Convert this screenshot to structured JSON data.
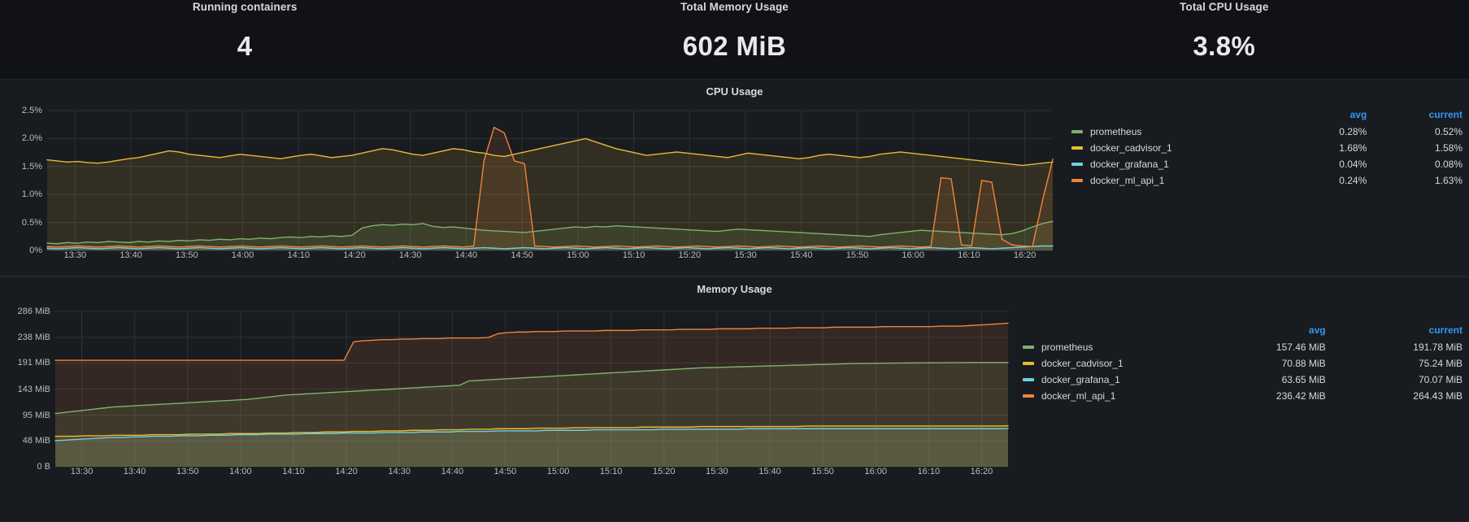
{
  "stats": [
    {
      "title": "Running containers",
      "value": "4"
    },
    {
      "title": "Total Memory Usage",
      "value": "602 MiB"
    },
    {
      "title": "Total CPU Usage",
      "value": "3.8%"
    }
  ],
  "legend_headers": {
    "series": "",
    "avg": "avg",
    "current": "current"
  },
  "colors": {
    "prometheus": "#7eb26d",
    "docker_cadvisor_1": "#eab839",
    "docker_grafana_1": "#6ed0e0",
    "docker_ml_api_1": "#ef843c",
    "panel_bg": "#181b1f",
    "page_bg": "#111217",
    "grid": "#2c3235",
    "axis_text": "#b9bcc1",
    "legend_header": "#3399f3"
  },
  "cpu_panel": {
    "title": "CPU Usage",
    "legend": [
      {
        "name": "prometheus",
        "color": "#7eb26d",
        "avg": "0.28%",
        "current": "0.52%"
      },
      {
        "name": "docker_cadvisor_1",
        "color": "#eab839",
        "avg": "1.68%",
        "current": "1.58%"
      },
      {
        "name": "docker_grafana_1",
        "color": "#6ed0e0",
        "avg": "0.04%",
        "current": "0.08%"
      },
      {
        "name": "docker_ml_api_1",
        "color": "#ef843c",
        "avg": "0.24%",
        "current": "1.63%"
      }
    ]
  },
  "memory_panel": {
    "title": "Memory Usage",
    "legend": [
      {
        "name": "prometheus",
        "color": "#7eb26d",
        "avg": "157.46 MiB",
        "current": "191.78 MiB"
      },
      {
        "name": "docker_cadvisor_1",
        "color": "#eab839",
        "avg": "70.88 MiB",
        "current": "75.24 MiB"
      },
      {
        "name": "docker_grafana_1",
        "color": "#6ed0e0",
        "avg": "63.65 MiB",
        "current": "70.07 MiB"
      },
      {
        "name": "docker_ml_api_1",
        "color": "#ef843c",
        "avg": "236.42 MiB",
        "current": "264.43 MiB"
      }
    ]
  },
  "chart_data": [
    {
      "type": "line",
      "title": "CPU Usage",
      "xlabel": "",
      "ylabel": "",
      "ylim": [
        0,
        2.5
      ],
      "yticks": [
        "0%",
        "0.5%",
        "1.0%",
        "1.5%",
        "2.0%",
        "2.5%"
      ],
      "ytick_values": [
        0,
        0.5,
        1.0,
        1.5,
        2.0,
        2.5
      ],
      "x": [
        "13:30",
        "13:40",
        "13:50",
        "14:00",
        "14:10",
        "14:20",
        "14:30",
        "14:40",
        "14:50",
        "15:00",
        "15:10",
        "15:20",
        "15:30",
        "15:40",
        "15:50",
        "16:00",
        "16:10",
        "16:20"
      ],
      "grid": true,
      "legend_position": "right",
      "fill": true,
      "series": [
        {
          "name": "prometheus",
          "color": "#7eb26d",
          "avg": 0.28,
          "current": 0.52,
          "values": [
            0.13,
            0.12,
            0.14,
            0.13,
            0.15,
            0.14,
            0.16,
            0.15,
            0.14,
            0.16,
            0.15,
            0.17,
            0.16,
            0.18,
            0.17,
            0.19,
            0.18,
            0.2,
            0.19,
            0.21,
            0.2,
            0.22,
            0.21,
            0.23,
            0.24,
            0.23,
            0.25,
            0.24,
            0.26,
            0.25,
            0.27,
            0.4,
            0.44,
            0.46,
            0.45,
            0.47,
            0.46,
            0.48,
            0.43,
            0.41,
            0.42,
            0.4,
            0.38,
            0.36,
            0.35,
            0.34,
            0.33,
            0.32,
            0.34,
            0.36,
            0.38,
            0.4,
            0.42,
            0.41,
            0.43,
            0.42,
            0.44,
            0.43,
            0.42,
            0.41,
            0.4,
            0.39,
            0.38,
            0.37,
            0.36,
            0.35,
            0.34,
            0.36,
            0.38,
            0.37,
            0.36,
            0.35,
            0.34,
            0.33,
            0.32,
            0.31,
            0.3,
            0.29,
            0.28,
            0.27,
            0.26,
            0.25,
            0.28,
            0.3,
            0.32,
            0.34,
            0.36,
            0.35,
            0.34,
            0.33,
            0.32,
            0.31,
            0.3,
            0.29,
            0.28,
            0.3,
            0.35,
            0.42,
            0.48,
            0.52
          ]
        },
        {
          "name": "docker_cadvisor_1",
          "color": "#eab839",
          "avg": 1.68,
          "current": 1.58,
          "values": [
            1.62,
            1.6,
            1.58,
            1.59,
            1.57,
            1.56,
            1.58,
            1.61,
            1.64,
            1.66,
            1.7,
            1.74,
            1.78,
            1.76,
            1.72,
            1.7,
            1.68,
            1.66,
            1.69,
            1.72,
            1.7,
            1.68,
            1.66,
            1.64,
            1.67,
            1.7,
            1.72,
            1.69,
            1.66,
            1.68,
            1.7,
            1.74,
            1.78,
            1.82,
            1.8,
            1.76,
            1.72,
            1.7,
            1.74,
            1.78,
            1.82,
            1.8,
            1.76,
            1.74,
            1.7,
            1.68,
            1.72,
            1.76,
            1.8,
            1.84,
            1.88,
            1.92,
            1.96,
            2.0,
            1.94,
            1.88,
            1.82,
            1.78,
            1.74,
            1.7,
            1.72,
            1.74,
            1.76,
            1.74,
            1.72,
            1.7,
            1.68,
            1.66,
            1.7,
            1.74,
            1.72,
            1.7,
            1.68,
            1.66,
            1.64,
            1.66,
            1.7,
            1.72,
            1.7,
            1.68,
            1.66,
            1.68,
            1.72,
            1.74,
            1.76,
            1.74,
            1.72,
            1.7,
            1.68,
            1.66,
            1.64,
            1.62,
            1.6,
            1.58,
            1.56,
            1.54,
            1.52,
            1.54,
            1.56,
            1.58
          ]
        },
        {
          "name": "docker_grafana_1",
          "color": "#6ed0e0",
          "avg": 0.04,
          "current": 0.08,
          "values": [
            0.04,
            0.03,
            0.04,
            0.05,
            0.04,
            0.03,
            0.04,
            0.05,
            0.04,
            0.03,
            0.04,
            0.05,
            0.04,
            0.03,
            0.04,
            0.05,
            0.04,
            0.03,
            0.04,
            0.05,
            0.04,
            0.03,
            0.04,
            0.05,
            0.04,
            0.03,
            0.04,
            0.05,
            0.04,
            0.03,
            0.04,
            0.05,
            0.04,
            0.03,
            0.04,
            0.05,
            0.04,
            0.03,
            0.04,
            0.05,
            0.04,
            0.03,
            0.04,
            0.05,
            0.04,
            0.03,
            0.04,
            0.05,
            0.04,
            0.03,
            0.04,
            0.05,
            0.04,
            0.03,
            0.04,
            0.05,
            0.04,
            0.03,
            0.04,
            0.05,
            0.04,
            0.03,
            0.04,
            0.05,
            0.04,
            0.03,
            0.04,
            0.05,
            0.04,
            0.03,
            0.04,
            0.05,
            0.04,
            0.03,
            0.04,
            0.05,
            0.04,
            0.03,
            0.04,
            0.05,
            0.04,
            0.03,
            0.04,
            0.05,
            0.04,
            0.03,
            0.04,
            0.05,
            0.04,
            0.03,
            0.04,
            0.05,
            0.04,
            0.03,
            0.04,
            0.05,
            0.06,
            0.07,
            0.08,
            0.08
          ]
        },
        {
          "name": "docker_ml_api_1",
          "color": "#ef843c",
          "avg": 0.24,
          "current": 1.63,
          "values": [
            0.07,
            0.06,
            0.07,
            0.08,
            0.07,
            0.06,
            0.07,
            0.08,
            0.07,
            0.06,
            0.07,
            0.08,
            0.07,
            0.06,
            0.07,
            0.08,
            0.07,
            0.06,
            0.07,
            0.08,
            0.07,
            0.06,
            0.07,
            0.08,
            0.07,
            0.06,
            0.07,
            0.08,
            0.07,
            0.06,
            0.07,
            0.08,
            0.07,
            0.06,
            0.07,
            0.08,
            0.07,
            0.06,
            0.07,
            0.08,
            0.07,
            0.06,
            0.08,
            1.6,
            2.2,
            2.1,
            1.6,
            1.55,
            0.08,
            0.07,
            0.06,
            0.07,
            0.08,
            0.07,
            0.06,
            0.07,
            0.08,
            0.07,
            0.06,
            0.07,
            0.08,
            0.07,
            0.06,
            0.07,
            0.08,
            0.07,
            0.06,
            0.07,
            0.08,
            0.07,
            0.06,
            0.07,
            0.08,
            0.07,
            0.06,
            0.07,
            0.08,
            0.07,
            0.06,
            0.07,
            0.08,
            0.07,
            0.06,
            0.07,
            0.08,
            0.07,
            0.06,
            0.07,
            1.3,
            1.28,
            0.1,
            0.08,
            1.25,
            1.22,
            0.2,
            0.1,
            0.08,
            0.07,
            0.9,
            1.63
          ]
        }
      ]
    },
    {
      "type": "line",
      "title": "Memory Usage",
      "xlabel": "",
      "ylabel": "",
      "ylim": [
        0,
        286
      ],
      "yticks": [
        "0 B",
        "48 MiB",
        "95 MiB",
        "143 MiB",
        "191 MiB",
        "238 MiB",
        "286 MiB"
      ],
      "ytick_values": [
        0,
        48,
        95,
        143,
        191,
        238,
        286
      ],
      "x": [
        "13:30",
        "13:40",
        "13:50",
        "14:00",
        "14:10",
        "14:20",
        "14:30",
        "14:40",
        "14:50",
        "15:00",
        "15:10",
        "15:20",
        "15:30",
        "15:40",
        "15:50",
        "16:00",
        "16:10",
        "16:20"
      ],
      "grid": true,
      "legend_position": "right",
      "fill": true,
      "series": [
        {
          "name": "prometheus",
          "color": "#7eb26d",
          "avg": 157.46,
          "current": 191.78,
          "values": [
            98,
            100,
            102,
            104,
            106,
            108,
            110,
            111,
            112,
            113,
            114,
            115,
            116,
            117,
            118,
            119,
            120,
            121,
            122,
            123,
            124,
            126,
            128,
            130,
            132,
            133,
            134,
            135,
            136,
            137,
            138,
            139,
            140,
            141,
            142,
            143,
            144,
            145,
            146,
            147,
            148,
            149,
            150,
            158,
            159,
            160,
            161,
            162,
            163,
            164,
            165,
            166,
            167,
            168,
            169,
            170,
            171,
            172,
            173,
            174,
            175,
            176,
            177,
            178,
            179,
            180,
            181,
            182,
            182.5,
            183,
            183.5,
            184,
            184.5,
            185,
            185.5,
            186,
            186.5,
            187,
            187.5,
            188,
            188.5,
            189,
            189.5,
            190,
            190.2,
            190.4,
            190.6,
            190.8,
            191,
            191.1,
            191.2,
            191.3,
            191.4,
            191.5,
            191.6,
            191.7,
            191.75,
            191.78,
            191.78,
            191.78
          ]
        },
        {
          "name": "docker_cadvisor_1",
          "color": "#eab839",
          "avg": 70.88,
          "current": 75.24,
          "values": [
            56,
            56,
            56,
            57,
            57,
            57,
            58,
            58,
            58,
            58,
            59,
            59,
            59,
            59,
            60,
            60,
            60,
            60,
            61,
            61,
            61,
            61,
            62,
            62,
            62,
            63,
            63,
            63,
            64,
            64,
            64,
            65,
            65,
            65,
            66,
            66,
            66,
            67,
            67,
            67,
            68,
            68,
            68,
            69,
            69,
            69,
            70,
            70,
            70,
            70,
            71,
            71,
            71,
            71,
            72,
            72,
            72,
            72,
            72,
            72,
            72,
            73,
            73,
            73,
            73,
            73,
            73,
            74,
            74,
            74,
            74,
            74,
            74,
            74,
            74,
            74,
            74,
            74,
            75,
            75,
            75,
            75,
            75,
            75,
            75,
            75,
            75,
            75,
            75,
            75,
            75,
            75,
            75,
            75,
            75,
            75,
            75,
            75,
            75,
            75.24
          ]
        },
        {
          "name": "docker_grafana_1",
          "color": "#6ed0e0",
          "avg": 63.65,
          "current": 70.07,
          "values": [
            48,
            49,
            50,
            51,
            52,
            53,
            54,
            54,
            55,
            55,
            56,
            56,
            56,
            57,
            57,
            57,
            58,
            58,
            58,
            59,
            59,
            59,
            60,
            60,
            60,
            60,
            61,
            61,
            61,
            61,
            62,
            62,
            62,
            62,
            63,
            63,
            63,
            63,
            64,
            64,
            64,
            64,
            65,
            65,
            65,
            65,
            66,
            66,
            66,
            66,
            66,
            67,
            67,
            67,
            67,
            67,
            68,
            68,
            68,
            68,
            68,
            68,
            68,
            69,
            69,
            69,
            69,
            69,
            69,
            69,
            69,
            69,
            70,
            70,
            70,
            70,
            70,
            70,
            70,
            70,
            70,
            70,
            70,
            70,
            70,
            70,
            70,
            70,
            70,
            70,
            70,
            70,
            70,
            70,
            70,
            70,
            70,
            70,
            70,
            70.07
          ]
        },
        {
          "name": "docker_ml_api_1",
          "color": "#ef843c",
          "avg": 236.42,
          "current": 264.43,
          "values": [
            196,
            196,
            196,
            196,
            196,
            196,
            196,
            196,
            196,
            196,
            196,
            196,
            196,
            196,
            196,
            196,
            196,
            196,
            196,
            196,
            196,
            196,
            196,
            196,
            196,
            196,
            196,
            196,
            196,
            196,
            196,
            230,
            232,
            233,
            234,
            234,
            235,
            235,
            236,
            236,
            236,
            237,
            237,
            237,
            237,
            238,
            245,
            247,
            248,
            248,
            249,
            249,
            249,
            250,
            250,
            250,
            250,
            251,
            251,
            251,
            251,
            252,
            252,
            252,
            252,
            253,
            253,
            253,
            253,
            254,
            254,
            254,
            254,
            255,
            255,
            255,
            255,
            256,
            256,
            256,
            256,
            257,
            257,
            257,
            257,
            257,
            258,
            258,
            258,
            258,
            258,
            258,
            259,
            259,
            259,
            260,
            261,
            262,
            263,
            264.43
          ]
        }
      ]
    }
  ]
}
